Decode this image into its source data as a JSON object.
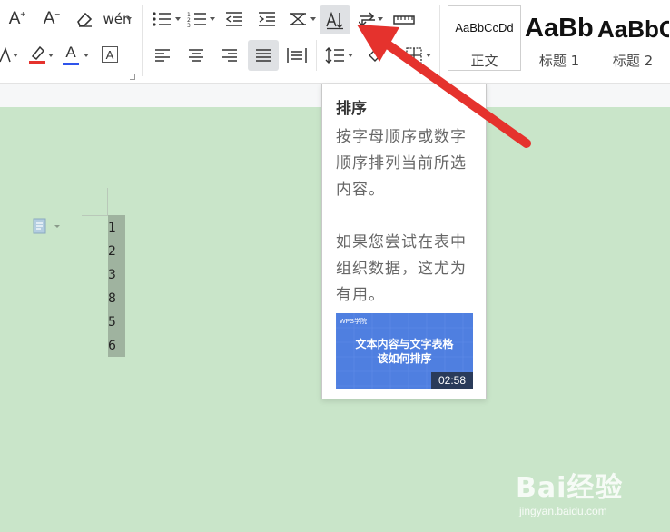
{
  "toolbar": {
    "phonetic_glyph": "wén",
    "font_color_letter": "A",
    "char_border_letter": "A",
    "increase_font_letter": "A",
    "decrease_font_letter": "A"
  },
  "styles": [
    {
      "sample": "AaBbCcDd",
      "name": "正文"
    },
    {
      "sample": "AaBb",
      "name": "标题 1"
    },
    {
      "sample": "AaBbC",
      "name": "标题 2"
    }
  ],
  "document": {
    "numbers": [
      "1",
      "2",
      "3",
      "8",
      "5",
      "6"
    ]
  },
  "tooltip": {
    "title": "排序",
    "body1": "按字母顺序或数字顺序排列当前所选内容。",
    "body2": "如果您尝试在表中组织数据，这尤为有用。",
    "video": {
      "logo": "WPS学院",
      "title_line1": "文本内容与文字表格",
      "title_line2": "该如何排序",
      "duration": "02:58"
    }
  },
  "watermark": {
    "brand": "Bai经验",
    "url": "jingyan.baidu.com"
  },
  "colors": {
    "accent_red": "#e5322d",
    "font_color_blue": "#2f54eb",
    "highlight_red": "#e5322d",
    "page_green": "#c9e5c9"
  }
}
